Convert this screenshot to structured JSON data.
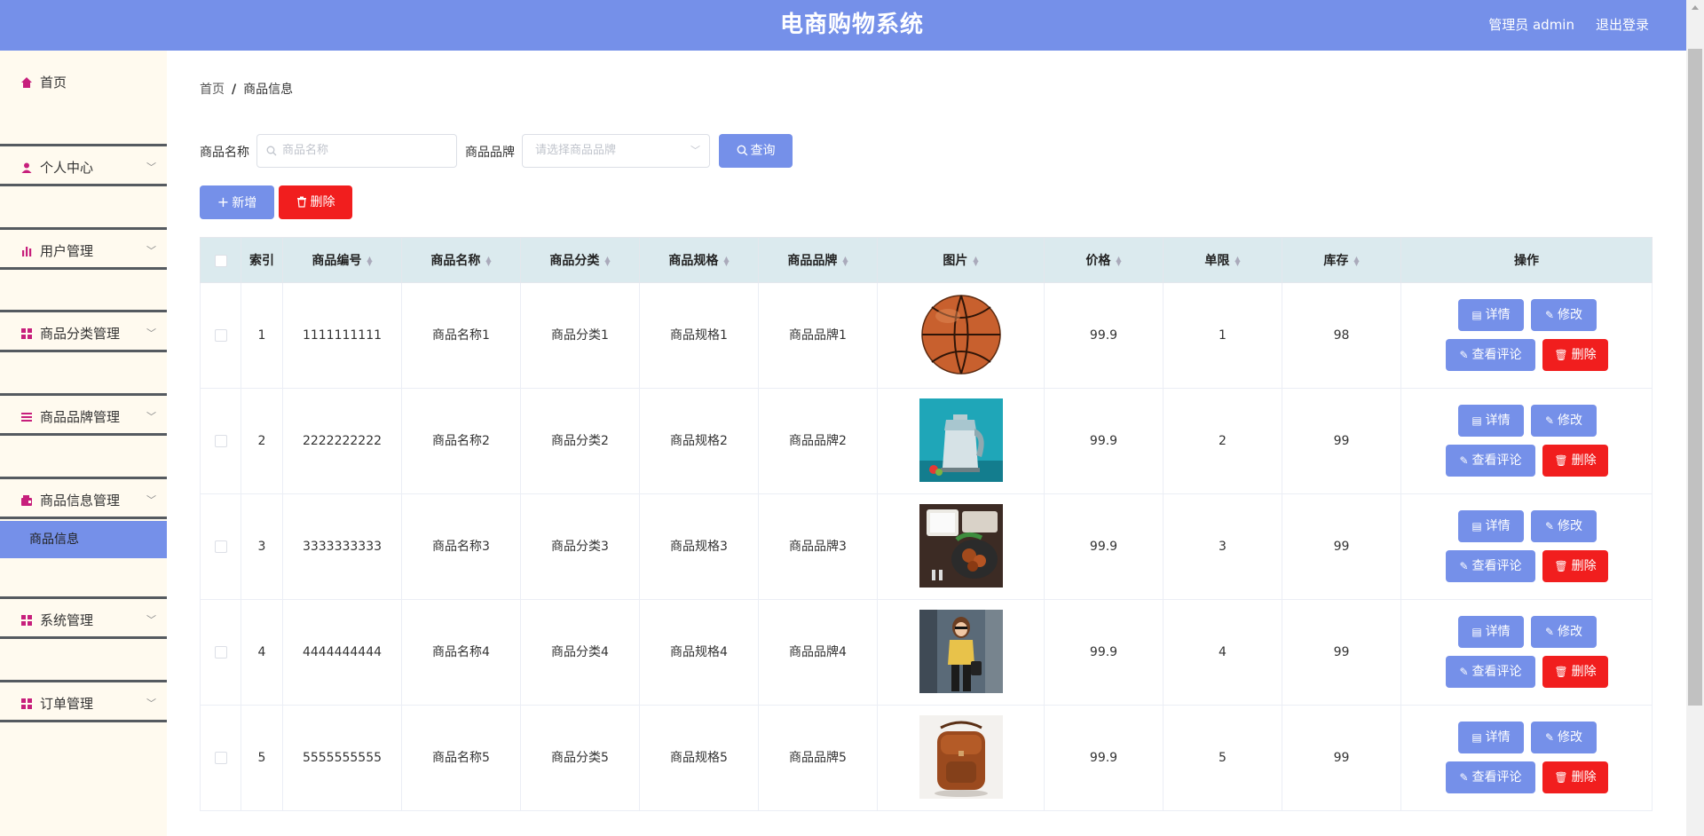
{
  "header": {
    "title": "电商购物系统",
    "admin_label": "管理员 admin",
    "logout_label": "退出登录",
    "bg_color": "#7590e9"
  },
  "sidebar": {
    "items": [
      {
        "label": "首页",
        "icon": "home-icon"
      },
      {
        "label": "个人中心",
        "icon": "user-icon"
      },
      {
        "label": "用户管理",
        "icon": "bar-chart-icon"
      },
      {
        "label": "商品分类管理",
        "icon": "grid-icon"
      },
      {
        "label": "商品品牌管理",
        "icon": "list-icon"
      },
      {
        "label": "商品信息管理",
        "icon": "wallet-icon",
        "sub": "商品信息"
      },
      {
        "label": "系统管理",
        "icon": "grid-icon"
      },
      {
        "label": "订单管理",
        "icon": "grid-icon"
      }
    ]
  },
  "breadcrumb": {
    "home": "首页",
    "current": "商品信息"
  },
  "search": {
    "name_label": "商品名称",
    "name_placeholder": "商品名称",
    "brand_label": "商品品牌",
    "brand_placeholder": "请选择商品品牌",
    "query_label": "查询"
  },
  "toolbar": {
    "add_label": "新增",
    "delete_label": "删除"
  },
  "table": {
    "headers": {
      "index": "索引",
      "code": "商品编号",
      "name": "商品名称",
      "category": "商品分类",
      "spec": "商品规格",
      "brand": "商品品牌",
      "image": "图片",
      "price": "价格",
      "limit": "单限",
      "stock": "库存",
      "ops": "操作"
    },
    "ops": {
      "detail": "详情",
      "edit": "修改",
      "comments": "查看评论",
      "delete": "删除"
    },
    "rows": [
      {
        "index": "1",
        "code": "1111111111",
        "name": "商品名称1",
        "category": "商品分类1",
        "spec": "商品规格1",
        "brand": "商品品牌1",
        "image": "basketball",
        "price": "99.9",
        "limit": "1",
        "stock": "98"
      },
      {
        "index": "2",
        "code": "2222222222",
        "name": "商品名称2",
        "category": "商品分类2",
        "spec": "商品规格2",
        "brand": "商品品牌2",
        "image": "kettle",
        "price": "99.9",
        "limit": "2",
        "stock": "99"
      },
      {
        "index": "3",
        "code": "3333333333",
        "name": "商品名称3",
        "category": "商品分类3",
        "spec": "商品规格3",
        "brand": "商品品牌3",
        "image": "food",
        "price": "99.9",
        "limit": "3",
        "stock": "99"
      },
      {
        "index": "4",
        "code": "4444444444",
        "name": "商品名称4",
        "category": "商品分类4",
        "spec": "商品规格4",
        "brand": "商品品牌4",
        "image": "woman",
        "price": "99.9",
        "limit": "4",
        "stock": "99"
      },
      {
        "index": "5",
        "code": "5555555555",
        "name": "商品名称5",
        "category": "商品分类5",
        "spec": "商品规格5",
        "brand": "商品品牌5",
        "image": "bag",
        "price": "99.9",
        "limit": "5",
        "stock": "99"
      }
    ]
  }
}
